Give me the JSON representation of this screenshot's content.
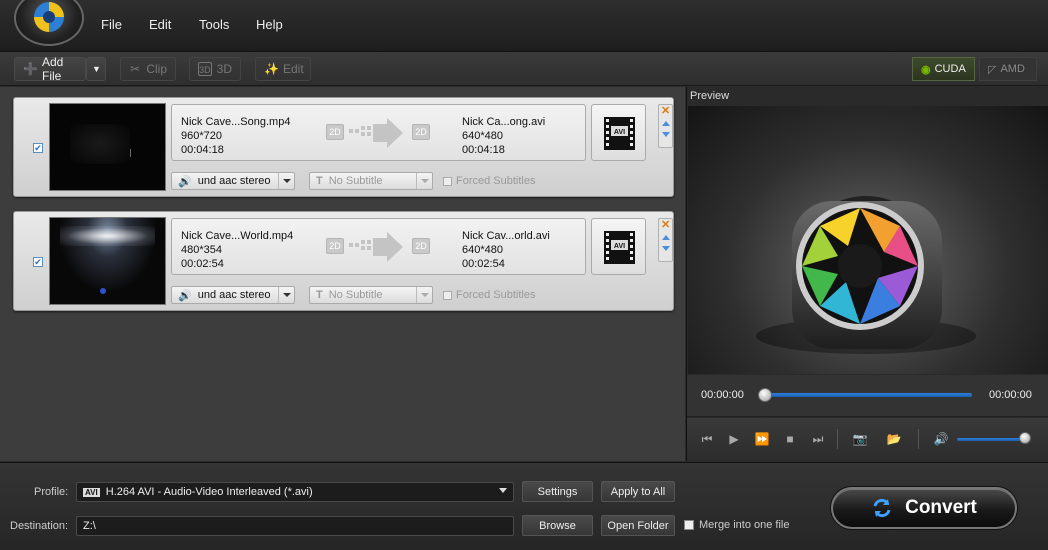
{
  "menu": [
    "File",
    "Edit",
    "Tools",
    "Help"
  ],
  "toolbar": {
    "add_file": "Add File",
    "clip": "Clip",
    "three_d": "3D",
    "edit": "Edit",
    "cuda": "CUDA",
    "amd": "AMD"
  },
  "files": [
    {
      "checked": true,
      "source_name": "Nick Cave...Song.mp4",
      "source_res": "960*720",
      "source_dur": "00:04:18",
      "in_mode": "2D",
      "out_mode": "2D",
      "target_name": "Nick Ca...ong.avi",
      "target_res": "640*480",
      "target_dur": "00:04:18",
      "format_label": "AVI",
      "audio": "und aac stereo",
      "subtitle": "No Subtitle",
      "forced": "Forced Subtitles"
    },
    {
      "checked": true,
      "source_name": "Nick Cave...World.mp4",
      "source_res": "480*354",
      "source_dur": "00:02:54",
      "in_mode": "2D",
      "out_mode": "2D",
      "target_name": "Nick Cav...orld.avi",
      "target_res": "640*480",
      "target_dur": "00:02:54",
      "format_label": "AVI",
      "audio": "und aac stereo",
      "subtitle": "No Subtitle",
      "forced": "Forced Subtitles"
    }
  ],
  "preview": {
    "title": "Preview",
    "time_current": "00:00:00",
    "time_total": "00:00:00",
    "seek_progress": 0,
    "volume_level": 1.0
  },
  "bottom": {
    "profile_label": "Profile:",
    "profile_value": "H.264 AVI - Audio-Video Interleaved (*.avi)",
    "profile_icon_label": "AVI",
    "settings": "Settings",
    "apply_all": "Apply to All",
    "destination_label": "Destination:",
    "destination_value": "Z:\\",
    "browse": "Browse",
    "open_folder": "Open Folder",
    "merge": "Merge into one file",
    "convert": "Convert"
  },
  "colors": {
    "accent_blue": "#2d7fd8",
    "cuda_green": "#76b900",
    "remove_orange": "#e07a10"
  }
}
